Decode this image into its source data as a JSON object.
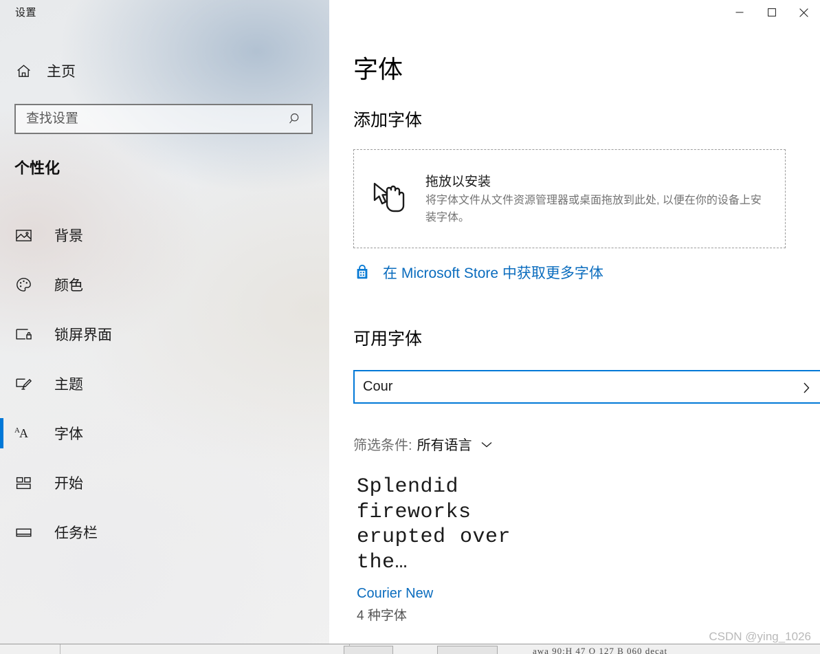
{
  "window": {
    "caption": "设置",
    "controls": {
      "minimize": "minimize-button",
      "maximize": "maximize-button",
      "close": "close-button"
    }
  },
  "sidebar": {
    "home": {
      "label": "主页",
      "icon": "home-icon"
    },
    "search": {
      "value": "",
      "placeholder": "查找设置",
      "icon": "search-icon"
    },
    "category_title": "个性化",
    "items": [
      {
        "label": "背景",
        "icon": "image-icon",
        "selected": false
      },
      {
        "label": "颜色",
        "icon": "palette-icon",
        "selected": false
      },
      {
        "label": "锁屏界面",
        "icon": "lockscreen-icon",
        "selected": false
      },
      {
        "label": "主题",
        "icon": "brush-icon",
        "selected": false
      },
      {
        "label": "字体",
        "icon": "font-aa-icon",
        "selected": true
      },
      {
        "label": "开始",
        "icon": "start-grid-icon",
        "selected": false
      },
      {
        "label": "任务栏",
        "icon": "taskbar-icon",
        "selected": false
      }
    ]
  },
  "main": {
    "page_title": "字体",
    "add_font_heading": "添加字体",
    "drop_zone": {
      "icon": "drag-drop-cursor-icon",
      "title": "拖放以安装",
      "description": "将字体文件从文件资源管理器或桌面拖放到此处, 以便在你的设备上安装字体。"
    },
    "store_link": {
      "icon": "microsoft-store-icon",
      "text": "在 Microsoft Store 中获取更多字体"
    },
    "available_heading": "可用字体",
    "font_search": {
      "value": "Cour",
      "placeholder": "",
      "chevron": "chevron-right-icon"
    },
    "filter": {
      "label": "筛选条件:",
      "value": "所有语言",
      "chevron": "chevron-down-icon"
    },
    "font_results": [
      {
        "preview_text": "Splendid fireworks erupted over the…",
        "name": "Courier New",
        "face_count": "4 种字体"
      }
    ]
  },
  "background_window": {
    "status_text": "awa 90:H    47 O 127 B   060         decat"
  },
  "watermark": "CSDN @ying_1026",
  "colors": {
    "accent": "#0078d7",
    "link": "#0a6cbe",
    "text": "#1b1b1b",
    "muted": "#737373"
  }
}
